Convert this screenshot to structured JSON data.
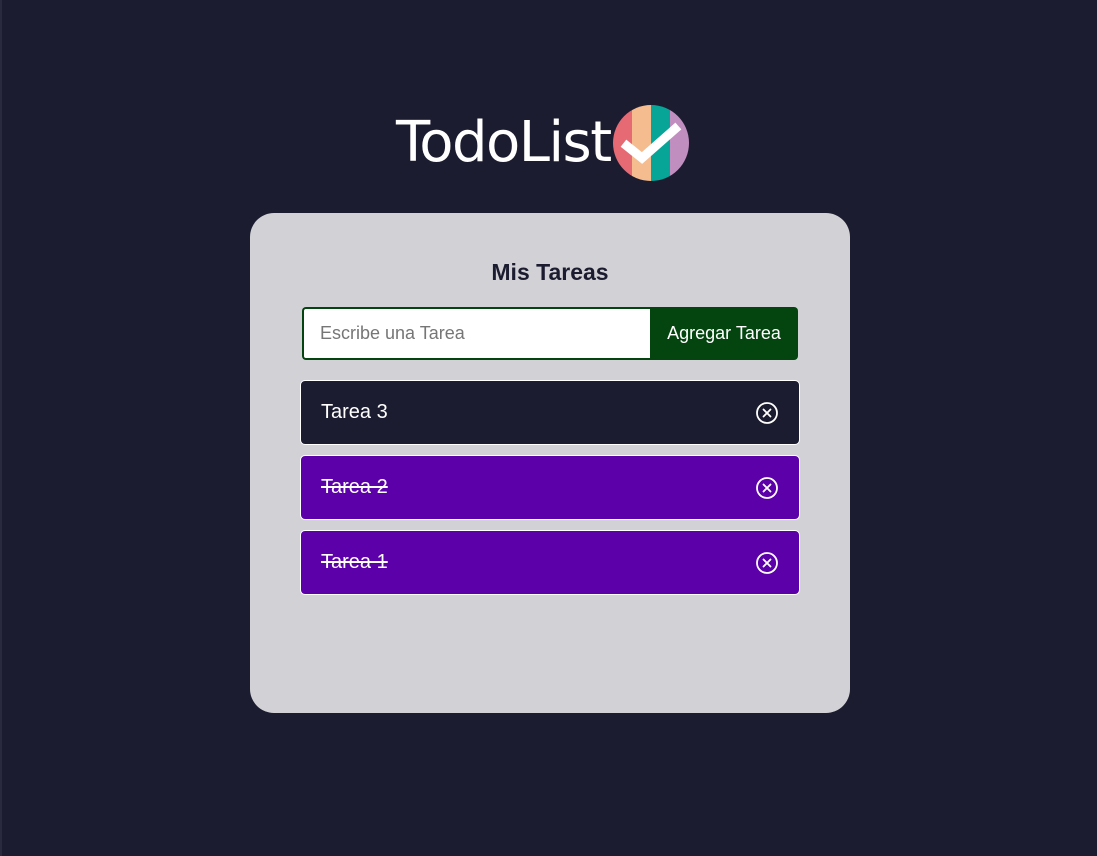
{
  "app": {
    "logo_text": "TodoList"
  },
  "card": {
    "title": "Mis Tareas"
  },
  "form": {
    "placeholder": "Escribe una Tarea",
    "value": "",
    "button_label": "Agregar Tarea"
  },
  "tasks": [
    {
      "label": "Tarea 3",
      "completed": false,
      "icon": "close-circle-icon"
    },
    {
      "label": "Tarea 2",
      "completed": true,
      "icon": "close-circle-icon"
    },
    {
      "label": "Tarea 1",
      "completed": true,
      "icon": "close-circle-icon"
    }
  ],
  "colors": {
    "background": "#1c1c30",
    "card": "#d1d1d6",
    "primary_green": "#03440f",
    "pending_task": "#1c1c30",
    "completed_task": "#5c00aa",
    "logo_stripes": [
      "#e66a73",
      "#f4bc8f",
      "#07a598",
      "#c08fc0"
    ]
  }
}
